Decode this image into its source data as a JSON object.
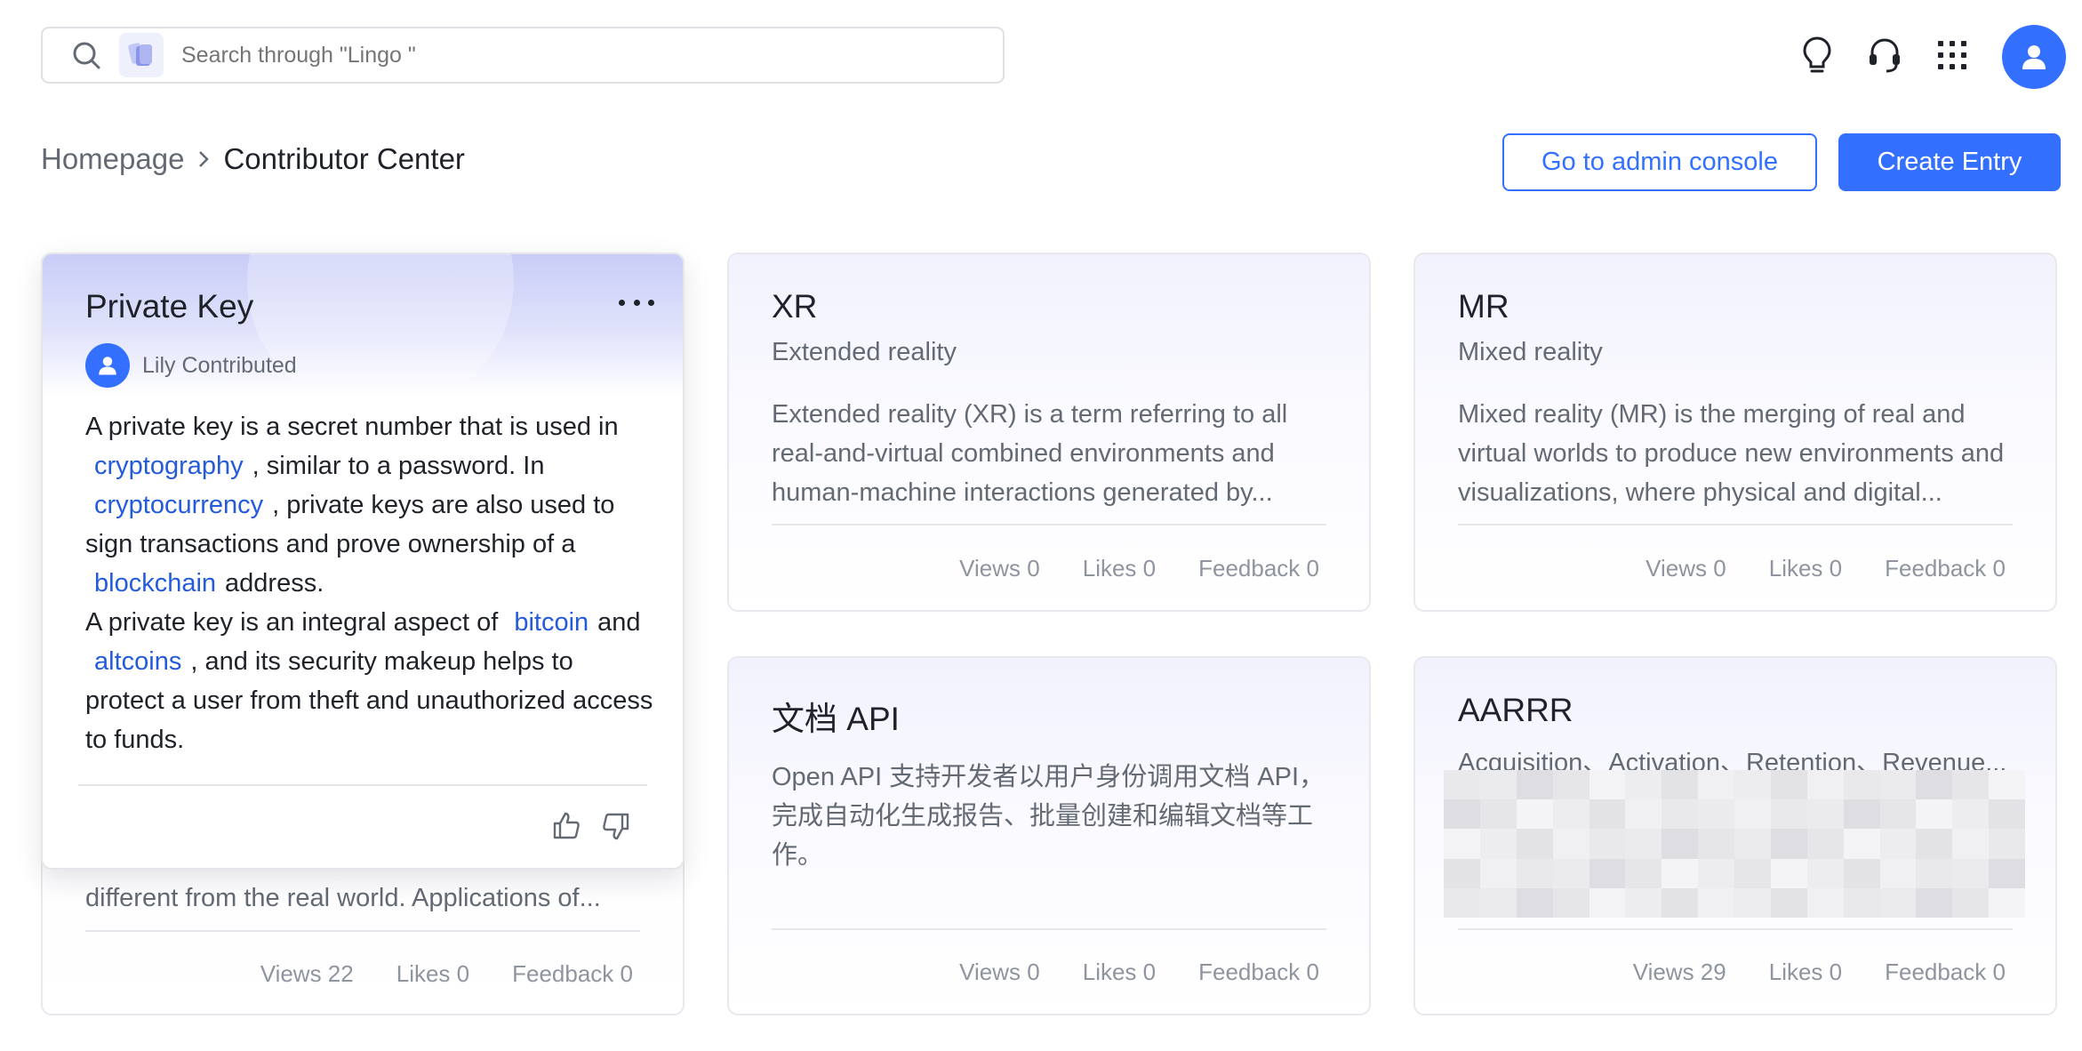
{
  "search": {
    "placeholder": "Search through \"Lingo \""
  },
  "toolbar": {
    "icons": [
      "lightbulb-icon",
      "headset-icon",
      "apps-grid-icon",
      "user-avatar"
    ]
  },
  "breadcrumb": {
    "home": "Homepage",
    "current": "Contributor Center"
  },
  "actions": {
    "admin_console": "Go to admin console",
    "create_entry": "Create Entry"
  },
  "colors": {
    "primary": "#3370ff",
    "link": "#245bdb",
    "text": "#1f2329",
    "muted": "#646a73"
  },
  "popup": {
    "title": "Private Key",
    "contributor": "Lily Contributed",
    "body": [
      {
        "type": "text",
        "value": "A private key is a secret number that is used in"
      },
      {
        "type": "link",
        "value": "cryptography"
      },
      {
        "type": "text",
        "value": ", similar to a password. In"
      },
      {
        "type": "link",
        "value": "cryptocurrency"
      },
      {
        "type": "text",
        "value": ", private keys are also used to sign transactions and prove ownership of a"
      },
      {
        "type": "link",
        "value": "blockchain"
      },
      {
        "type": "text",
        "value": "address."
      },
      {
        "type": "text",
        "value": "A private key is an integral aspect of"
      },
      {
        "type": "link",
        "value": "bitcoin"
      },
      {
        "type": "text",
        "value": "and"
      },
      {
        "type": "link",
        "value": "altcoins"
      },
      {
        "type": "text",
        "value": ", and its security makeup helps to protect a user from theft and unauthorized access to funds."
      }
    ]
  },
  "cards": [
    {
      "title": "",
      "subtitle": "",
      "description": "different from the real world. Applications of...",
      "views": "Views 22",
      "likes": "Likes 0",
      "feedback": "Feedback 0"
    },
    {
      "title": "XR",
      "subtitle": "Extended reality",
      "description": "Extended reality (XR) is a term referring to all real-and-virtual combined environments and human-machine interactions generated by...",
      "views": "Views 0",
      "likes": "Likes 0",
      "feedback": "Feedback 0"
    },
    {
      "title": "MR",
      "subtitle": "Mixed reality",
      "description": "Mixed reality (MR) is the merging of real and virtual worlds to produce new environments and visualizations, where physical and digital...",
      "views": "Views 0",
      "likes": "Likes 0",
      "feedback": "Feedback 0"
    },
    {
      "title": "文档 API",
      "subtitle": "",
      "description": "Open API 支持开发者以用户身份调用文档 API，完成自动化生成报告、批量创建和编辑文档等工作。",
      "views": "Views 0",
      "likes": "Likes 0",
      "feedback": "Feedback 0"
    },
    {
      "title": "AARRR",
      "subtitle": "Acquisition、Activation、Retention、Revenue...",
      "description": "",
      "views": "Views 29",
      "likes": "Likes 0",
      "feedback": "Feedback 0"
    }
  ]
}
